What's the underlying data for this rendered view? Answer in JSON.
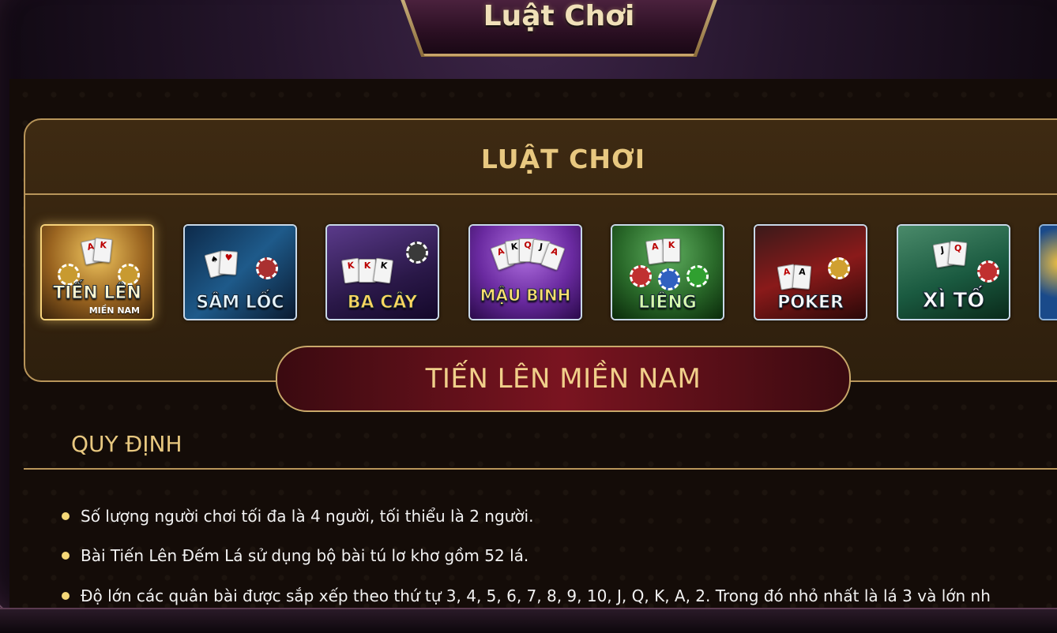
{
  "header": {
    "title": "Luật Chơi"
  },
  "panel": {
    "title": "LUẬT CHƠI"
  },
  "games": [
    {
      "label": "TIẾN LÊN",
      "sub": "MIỀN NAM",
      "selected": true,
      "icon": "tien-len-tile"
    },
    {
      "label": "SÂM LỐC",
      "sub": "",
      "selected": false,
      "icon": "sam-loc-tile"
    },
    {
      "label": "BA CÂY",
      "sub": "",
      "selected": false,
      "icon": "ba-cay-tile"
    },
    {
      "label": "MẬU BINH",
      "sub": "",
      "selected": false,
      "icon": "mau-binh-tile"
    },
    {
      "label": "LIÊNG",
      "sub": "",
      "selected": false,
      "icon": "lieng-tile"
    },
    {
      "label": "POKER",
      "sub": "",
      "selected": false,
      "icon": "poker-tile"
    },
    {
      "label": "XÌ TỐ",
      "sub": "",
      "selected": false,
      "icon": "xi-to-tile"
    }
  ],
  "selected_game": {
    "title": "TIẾN LÊN MIỀN NAM"
  },
  "rules": {
    "heading": "QUY ĐỊNH",
    "items": [
      "Số lượng người chơi tối đa là 4 người, tối thiểu là 2 người.",
      "Bài Tiến Lên Đếm Lá sử dụng bộ bài tú lơ khơ gồm 52 lá.",
      "Độ lớn các quân bài được sắp xếp theo thứ tự 3, 4, 5, 6, 7, 8, 9, 10, J, Q, K, A, 2. Trong đó nhỏ nhất là lá 3 và lớn nh"
    ]
  },
  "colors": {
    "gold": "#e8c880",
    "border": "#b8955a",
    "banner": "#7a1420"
  }
}
